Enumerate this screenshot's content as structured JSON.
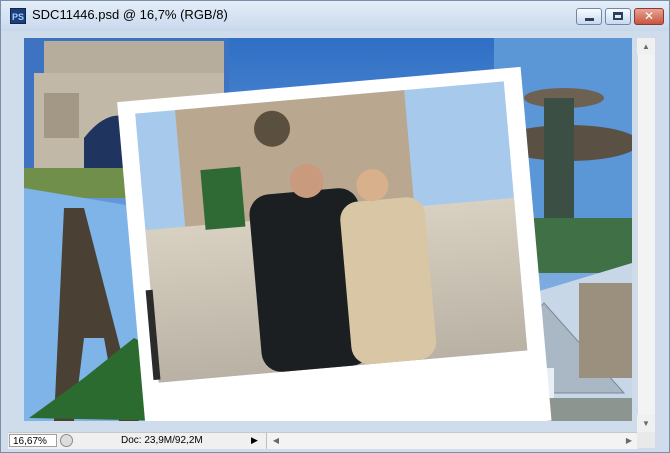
{
  "window": {
    "app_icon": "PS",
    "title": "SDC11446.psd @ 16,7% (RGB/8)",
    "buttons": {
      "minimize": "minimize-icon",
      "maximize": "maximize-icon",
      "close": "close-icon",
      "close_glyph": "✕"
    }
  },
  "colors": {
    "titlebar": "#d6e3f3",
    "close_button": "#c8543f",
    "sky": "#5d8fd0"
  },
  "status": {
    "zoom": "16,67%",
    "doc_info": "Doc: 23,9M/92,2M",
    "arrow": "▶"
  },
  "scroll": {
    "up": "▲",
    "down": "▼",
    "left": "◀",
    "right": "▶"
  }
}
